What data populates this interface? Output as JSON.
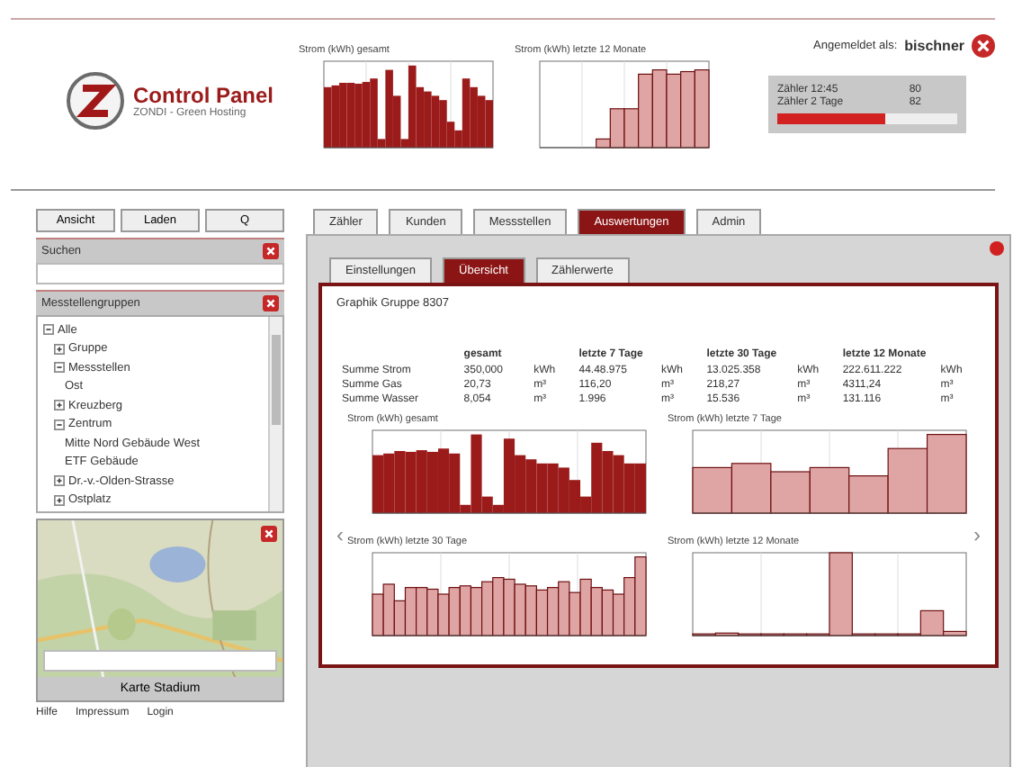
{
  "header": {
    "logo_title": "Control Panel",
    "logo_subtitle": "ZONDI - Green Hosting",
    "login_label": "Angemeldet als:",
    "login_user": "bischner",
    "chart_titles": [
      "Strom (kWh) gesamt",
      "Strom (kWh) letzte 12 Monate"
    ],
    "info": [
      {
        "label": "Zähler 12:45",
        "value": "80"
      },
      {
        "label": "Zähler 2 Tage",
        "value": "82"
      }
    ],
    "alarm_bar": {
      "level": 0.6
    }
  },
  "sidebar": {
    "buttons": [
      "Ansicht",
      "Laden",
      "Q"
    ],
    "search": {
      "title": "Suchen"
    },
    "groups": {
      "title": "Messtellengruppen",
      "tree": [
        {
          "label": "Alle",
          "expanded": true,
          "children": [
            {
              "label": "Gruppe",
              "expanded": false
            },
            {
              "label": "Messstellen",
              "expanded": true,
              "children": [
                {
                  "label": "Ost"
                }
              ]
            },
            {
              "label": "Kreuzberg",
              "expanded": false
            },
            {
              "label": "Zentrum",
              "expanded": true,
              "children": [
                {
                  "label": "Mitte Nord Gebäude West"
                },
                {
                  "label": "ETF Gebäude"
                }
              ]
            },
            {
              "label": "Dr.-v.-Olden-Strasse",
              "expanded": false
            },
            {
              "label": "Ostplatz",
              "expanded": false
            }
          ]
        }
      ]
    },
    "map": {
      "kind": "picture",
      "button": "Karte Stadium"
    },
    "links": [
      "Hilfe",
      "Impressum",
      "Login"
    ]
  },
  "tabs": [
    {
      "label": "Zähler",
      "selected": false
    },
    {
      "label": "Kunden",
      "selected": false
    },
    {
      "label": "Messstellen",
      "selected": false
    },
    {
      "label": "Auswertungen",
      "selected": true
    },
    {
      "label": "Admin",
      "selected": false
    }
  ],
  "subtabs": [
    {
      "label": "Einstellungen",
      "selected": false
    },
    {
      "label": "Übersicht",
      "selected": true
    },
    {
      "label": "Zählerwerte",
      "selected": false
    }
  ],
  "content": {
    "title": "Graphik Gruppe 8307",
    "table": {
      "columns": [
        "gesamt",
        "letzte 7 Tage",
        "letzte 30 Tage",
        "letzte 12 Monate"
      ],
      "rows": [
        {
          "name": "Summe Strom",
          "cells": [
            [
              "350,000",
              "kWh"
            ],
            [
              "44.48.975",
              "kWh"
            ],
            [
              "13.025.358",
              "kWh"
            ],
            [
              "222.611.222",
              "kWh"
            ]
          ]
        },
        {
          "name": "Summe Gas",
          "cells": [
            [
              "20,73",
              "m³"
            ],
            [
              "116,20",
              "m³"
            ],
            [
              "218,27",
              "m³"
            ],
            [
              "4311,24",
              "m³"
            ]
          ]
        },
        {
          "name": "Summe Wasser",
          "cells": [
            [
              "8,054",
              "m³"
            ],
            [
              "1.996",
              "m³"
            ],
            [
              "15.536",
              "m³"
            ],
            [
              "131.116",
              "m³"
            ]
          ]
        }
      ]
    },
    "chart_titles": [
      "Strom (kWh) gesamt",
      "Strom (kWh) letzte 7 Tage",
      "Strom (kWh) letzte 30 Tage",
      "Strom (kWh) letzte 12 Monate"
    ],
    "prev": "‹",
    "next": "›"
  }
}
